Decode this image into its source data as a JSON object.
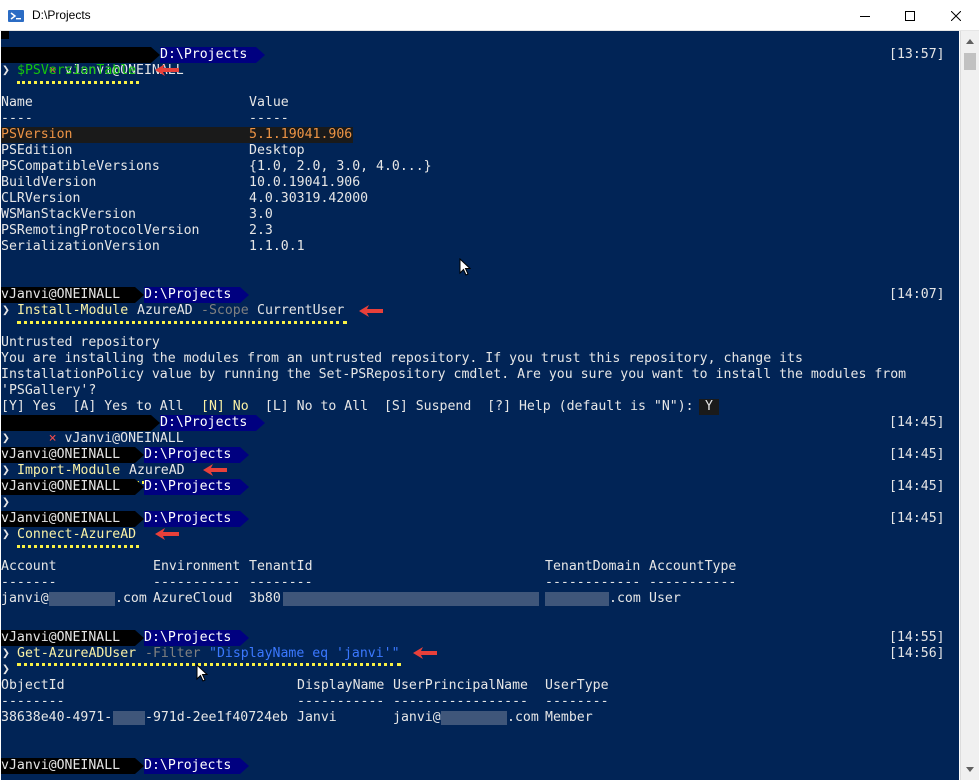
{
  "window": {
    "title": "D:\\Projects",
    "minimize_icon": "minimize-icon",
    "maximize_icon": "maximize-icon",
    "close_icon": "close-icon"
  },
  "prompt": {
    "user": "vJanvi@ONEINALL",
    "path": "D:\\Projects",
    "chevron": "❯",
    "error_mark": "×"
  },
  "block1": {
    "time": "[13:57]",
    "command": "$PSVersionTable",
    "header_name": "Name",
    "header_value": "Value",
    "sep_name": "----",
    "sep_value": "-----",
    "rows": [
      {
        "name": "PSVersion",
        "value": "5.1.19041.906"
      },
      {
        "name": "PSEdition",
        "value": "Desktop"
      },
      {
        "name": "PSCompatibleVersions",
        "value": "{1.0, 2.0, 3.0, 4.0...}"
      },
      {
        "name": "BuildVersion",
        "value": "10.0.19041.906"
      },
      {
        "name": "CLRVersion",
        "value": "4.0.30319.42000"
      },
      {
        "name": "WSManStackVersion",
        "value": "3.0"
      },
      {
        "name": "PSRemotingProtocolVersion",
        "value": "2.3"
      },
      {
        "name": "SerializationVersion",
        "value": "1.1.0.1"
      }
    ]
  },
  "block2": {
    "time": "[14:07]",
    "cmd": "Install-Module",
    "arg": "AzureAD",
    "param": "-Scope",
    "param_value": "CurrentUser",
    "msg_title": "Untrusted repository",
    "msg_line1": "You are installing the modules from an untrusted repository. If you trust this repository, change its",
    "msg_line2": "InstallationPolicy value by running the Set-PSRepository cmdlet. Are you sure you want to install the modules from",
    "msg_line3": "'PSGallery'?",
    "choice_a": "[Y] Yes  [A] Yes to All  ",
    "choice_n": "[N] No",
    "choice_b": "  [L] No to All  [S] Suspend  [?] Help (default is \"N\"): ",
    "answer": "Y"
  },
  "block3": {
    "time": "[14:45]"
  },
  "block4": {
    "time": "[14:45]",
    "cmd": "Import-Module",
    "arg": "AzureAD"
  },
  "block5": {
    "time": "[14:45]"
  },
  "block6": {
    "time": "[14:45]",
    "cmd": "Connect-AzureAD",
    "headers": [
      "Account",
      "Environment",
      "TenantId",
      "TenantDomain",
      "AccountType"
    ],
    "seps": [
      "-------",
      "-----------",
      "--------",
      "------------",
      "-----------"
    ],
    "account_prefix": "janvi@",
    "account_suffix": ".com",
    "environment": "AzureCloud",
    "tenant_prefix": "3b80",
    "domain_suffix": ".com",
    "account_type": "User"
  },
  "block7": {
    "time": "[14:55]",
    "time2": "[14:56]",
    "cmd": "Get-AzureADUser",
    "param": "-Filter",
    "filter": "\"DisplayName eq 'janvi'\"",
    "headers": [
      "ObjectId",
      "DisplayName",
      "UserPrincipalName",
      "UserType"
    ],
    "seps": [
      "--------",
      "-----------",
      "-----------------",
      "--------"
    ],
    "object_prefix": "38638e40-4971-",
    "object_suffix": "-971d-2ee1f40724eb",
    "display_name": "Janvi",
    "upn_prefix": "janvi@",
    "upn_suffix": ".com",
    "user_type": "Member"
  },
  "colors": {
    "console_bg": "#012456",
    "annotation_arrow": "#e8403a",
    "annotation_underline": "#f9f145"
  }
}
